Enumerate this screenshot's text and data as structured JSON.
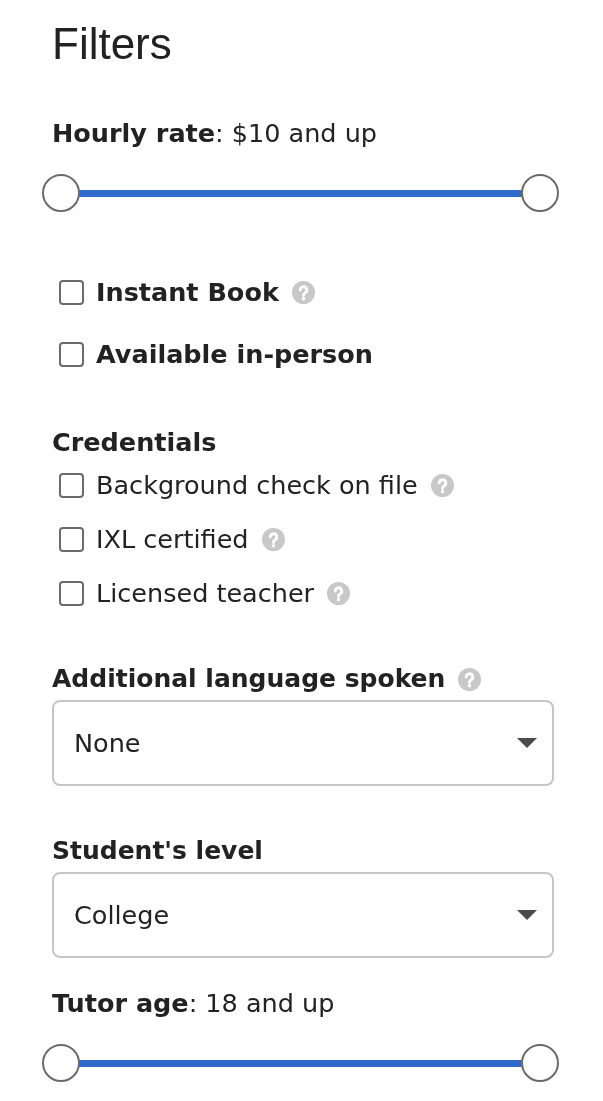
{
  "title": "Filters",
  "filters": [
    {
      "kind": "range",
      "label": "**Hourly rate**: $10 and up",
      "thumbs": [
        {
          "level": 0
        },
        {
          "level": 1
        }
      ]
    },
    {
      "kind": "checkbox",
      "label": "Instant Book",
      "checked": false,
      "help": true
    },
    {
      "kind": "checkbox",
      "label": "Available in-person",
      "checked": false,
      "help": false
    },
    {
      "kind": "group",
      "heading": "Credentials",
      "options": [
        {
          "label": "Background check on file",
          "checked": false,
          "help": true
        },
        {
          "label": "IXL certified",
          "checked": false,
          "help": true
        },
        {
          "label": "Licensed teacher",
          "checked": false,
          "help": true
        }
      ]
    },
    {
      "kind": "select",
      "label": "Additional language spoken",
      "help": true,
      "value": "None"
    },
    {
      "kind": "select",
      "label": "Student's level",
      "help": false,
      "value": "College"
    },
    {
      "kind": "range",
      "label": "**Tutor age**: 18 and up",
      "thumbs": [
        {
          "level": 0
        },
        {
          "level": 1
        }
      ]
    }
  ]
}
